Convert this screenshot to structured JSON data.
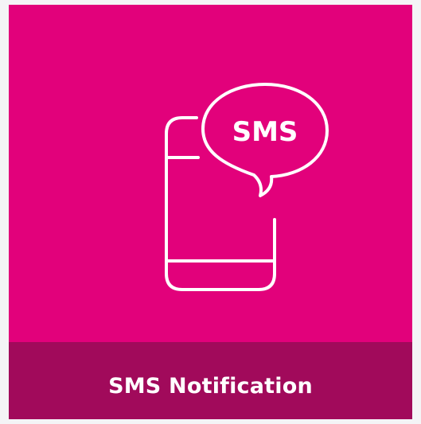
{
  "tile": {
    "background_color": "#e2017b",
    "footer_color": "#a10a5b",
    "icon": "phone-with-sms-bubble-icon",
    "bubble_text": "SMS",
    "label": "SMS Notification"
  }
}
